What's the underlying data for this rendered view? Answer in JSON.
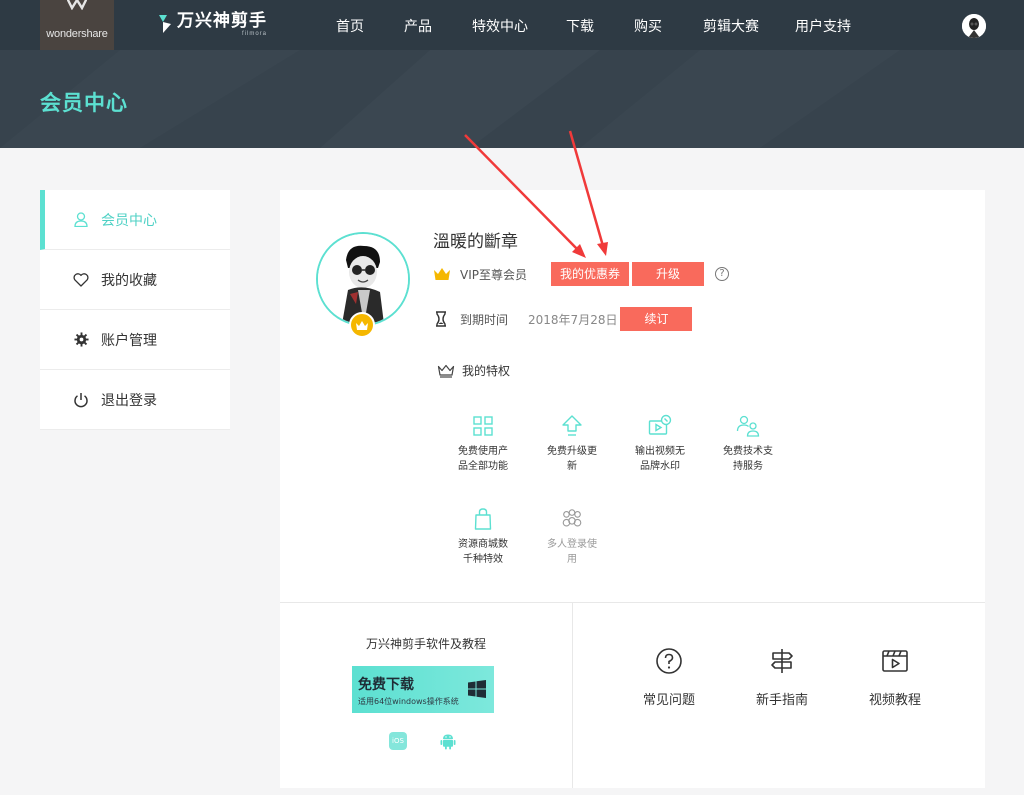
{
  "topbar": {
    "company_logo": "wondershare",
    "brand_name": "万兴神剪手",
    "brand_sub": "filmora",
    "nav": [
      "首页",
      "产品",
      "特效中心",
      "下载",
      "购买",
      "剪辑大赛",
      "用户支持"
    ]
  },
  "header": {
    "title": "会员中心"
  },
  "sidebar": {
    "items": [
      {
        "label": "会员中心",
        "icon": "user-icon",
        "active": true
      },
      {
        "label": "我的收藏",
        "icon": "heart-icon",
        "active": false
      },
      {
        "label": "账户管理",
        "icon": "gear-icon",
        "active": false
      },
      {
        "label": "退出登录",
        "icon": "power-icon",
        "active": false
      }
    ]
  },
  "profile": {
    "username": "溫暖的斷章",
    "vip_level": "VIP至尊会员",
    "coupon_button": "我的优惠券",
    "upgrade_button": "升级",
    "help": "?",
    "expire_label": "到期时间",
    "expire_date": "2018年7月28日",
    "renew_button": "续订"
  },
  "privileges": {
    "title": "我的特权",
    "items": [
      {
        "line1": "免费使用产",
        "line2": "品全部功能",
        "icon": "grid-icon"
      },
      {
        "line1": "免费升级更",
        "line2": "新",
        "icon": "upgrade-arrow-icon"
      },
      {
        "line1": "输出视频无",
        "line2": "品牌水印",
        "icon": "video-watermark-icon"
      },
      {
        "line1": "免费技术支",
        "line2": "持服务",
        "icon": "support-users-icon"
      },
      {
        "line1": "资源商城数",
        "line2": "千种特效",
        "icon": "shopping-bag-icon"
      },
      {
        "line1": "多人登录使",
        "line2": "用",
        "icon": "multi-user-icon"
      }
    ]
  },
  "download": {
    "title": "万兴神剪手软件及教程",
    "button_main": "免费下载",
    "button_sub": "适用64位windows操作系统",
    "ios_label": "iOS"
  },
  "resources": [
    {
      "label": "常见问题",
      "icon": "question-icon"
    },
    {
      "label": "新手指南",
      "icon": "signpost-icon"
    },
    {
      "label": "视频教程",
      "icon": "video-tutorial-icon"
    }
  ],
  "colors": {
    "accent": "#5ce0d1",
    "red": "#f96a5c",
    "topbar": "#2e3a44",
    "header": "#37434d",
    "gold": "#f5b700"
  }
}
